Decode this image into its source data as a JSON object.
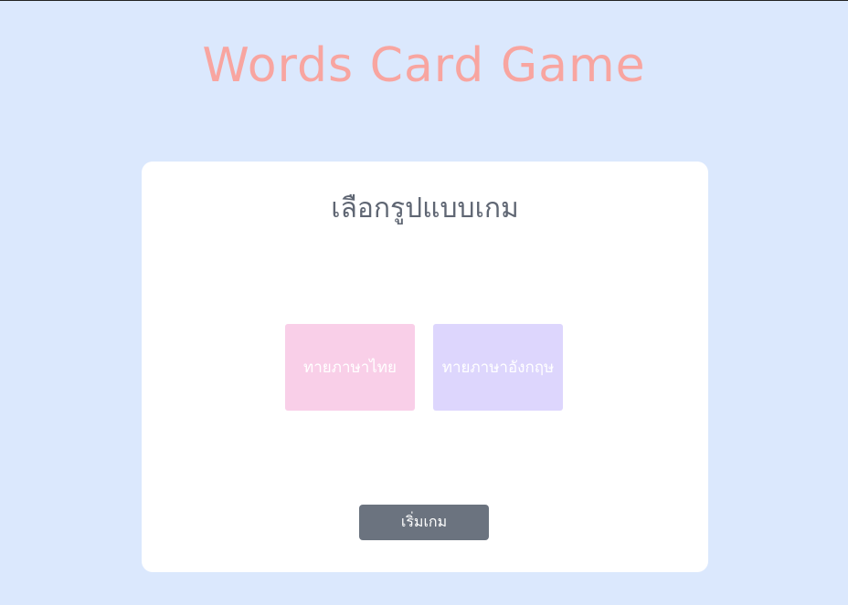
{
  "header": {
    "title": "Words Card Game"
  },
  "panel": {
    "heading": "เลือกรูปแบบเกม",
    "modes": [
      {
        "label": "ทายภาษาไทย",
        "color": "#f9cfe8"
      },
      {
        "label": "ทายภาษาอังกฤษ",
        "color": "#ddd6fd"
      }
    ],
    "start_label": "เริ่มเกม"
  },
  "colors": {
    "background": "#dbe8fd",
    "title": "#f8a5a0",
    "heading": "#5f6673",
    "start_button": "#6b737f",
    "panel": "#ffffff"
  }
}
